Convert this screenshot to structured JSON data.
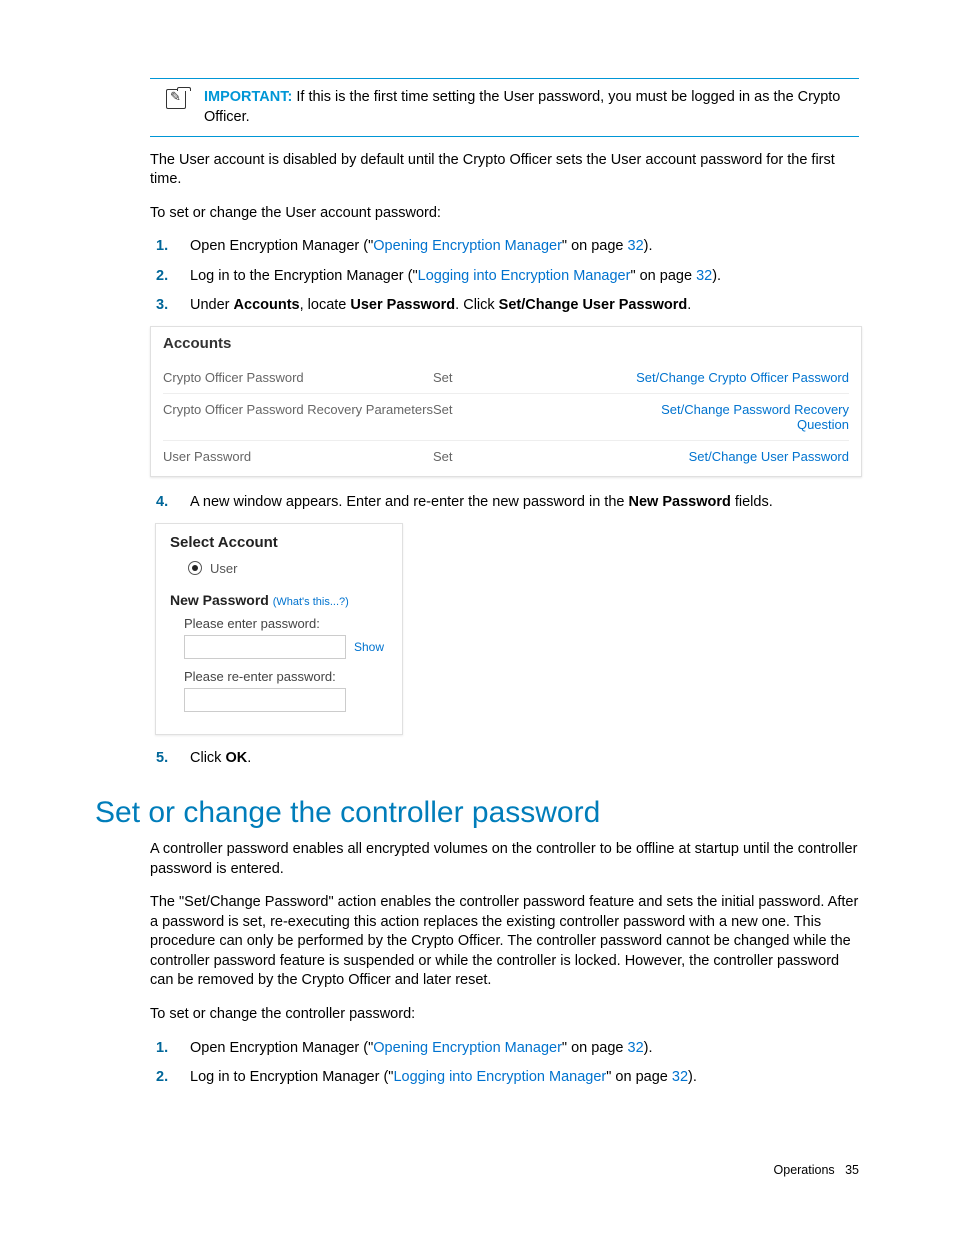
{
  "important": {
    "label": "IMPORTANT:",
    "text": "If this is the first time setting the User password, you must be logged in as the Crypto Officer."
  },
  "intro1": "The User account is disabled by default until the Crypto Officer sets the User account password for the first time.",
  "intro2": "To set or change the User account password:",
  "steps_a": {
    "s1_pre": "Open Encryption Manager (\"",
    "s1_link": "Opening Encryption Manager",
    "s1_mid": "\" on page ",
    "s1_page": "32",
    "s1_post": ").",
    "s2_pre": "Log in to the Encryption Manager (\"",
    "s2_link": "Logging into Encryption Manager",
    "s2_mid": "\" on page ",
    "s2_page": "32",
    "s2_post": ").",
    "s3_a": "Under ",
    "s3_b": "Accounts",
    "s3_c": ", locate ",
    "s3_d": "User Password",
    "s3_e": ". Click ",
    "s3_f": "Set/Change User Password",
    "s3_g": ".",
    "s4_a": "A new window appears. Enter and re-enter the new password in the ",
    "s4_b": "New Password",
    "s4_c": " fields.",
    "s5_a": "Click ",
    "s5_b": "OK",
    "s5_c": "."
  },
  "accounts": {
    "title": "Accounts",
    "rows": [
      {
        "name": "Crypto Officer Password",
        "status": "Set",
        "action": "Set/Change Crypto Officer Password"
      },
      {
        "name": "Crypto Officer Password Recovery Parameters",
        "status": "Set",
        "action": "Set/Change Password Recovery Question"
      },
      {
        "name": "User Password",
        "status": "Set",
        "action": "Set/Change User Password"
      }
    ]
  },
  "select": {
    "title": "Select Account",
    "radio_label": "User",
    "newpw": "New Password",
    "hint": "(What's this...?)",
    "enter": "Please enter password:",
    "reenter": "Please re-enter password:",
    "show": "Show"
  },
  "heading2": "Set or change the controller password",
  "ctrl_p1": "A controller password enables all encrypted volumes on the controller to be offline at startup until the controller password is entered.",
  "ctrl_p2": "The \"Set/Change Password\" action enables the controller password feature and sets the initial password. After a password is set, re-executing this action replaces the existing controller password with a new one. This procedure can only be performed by the Crypto Officer. The controller password cannot be changed while the controller password feature is suspended or while the controller is locked. However, the controller password can be removed by the Crypto Officer and later reset.",
  "ctrl_p3": "To set or change the controller password:",
  "steps_b": {
    "s1_pre": "Open Encryption Manager (\"",
    "s1_link": "Opening Encryption Manager",
    "s1_mid": "\" on page ",
    "s1_page": "32",
    "s1_post": ").",
    "s2_pre": "Log in to Encryption Manager (\"",
    "s2_link": "Logging into Encryption Manager",
    "s2_mid": "\" on page ",
    "s2_page": "32",
    "s2_post": ")."
  },
  "footer": {
    "label": "Operations",
    "page": "35"
  }
}
